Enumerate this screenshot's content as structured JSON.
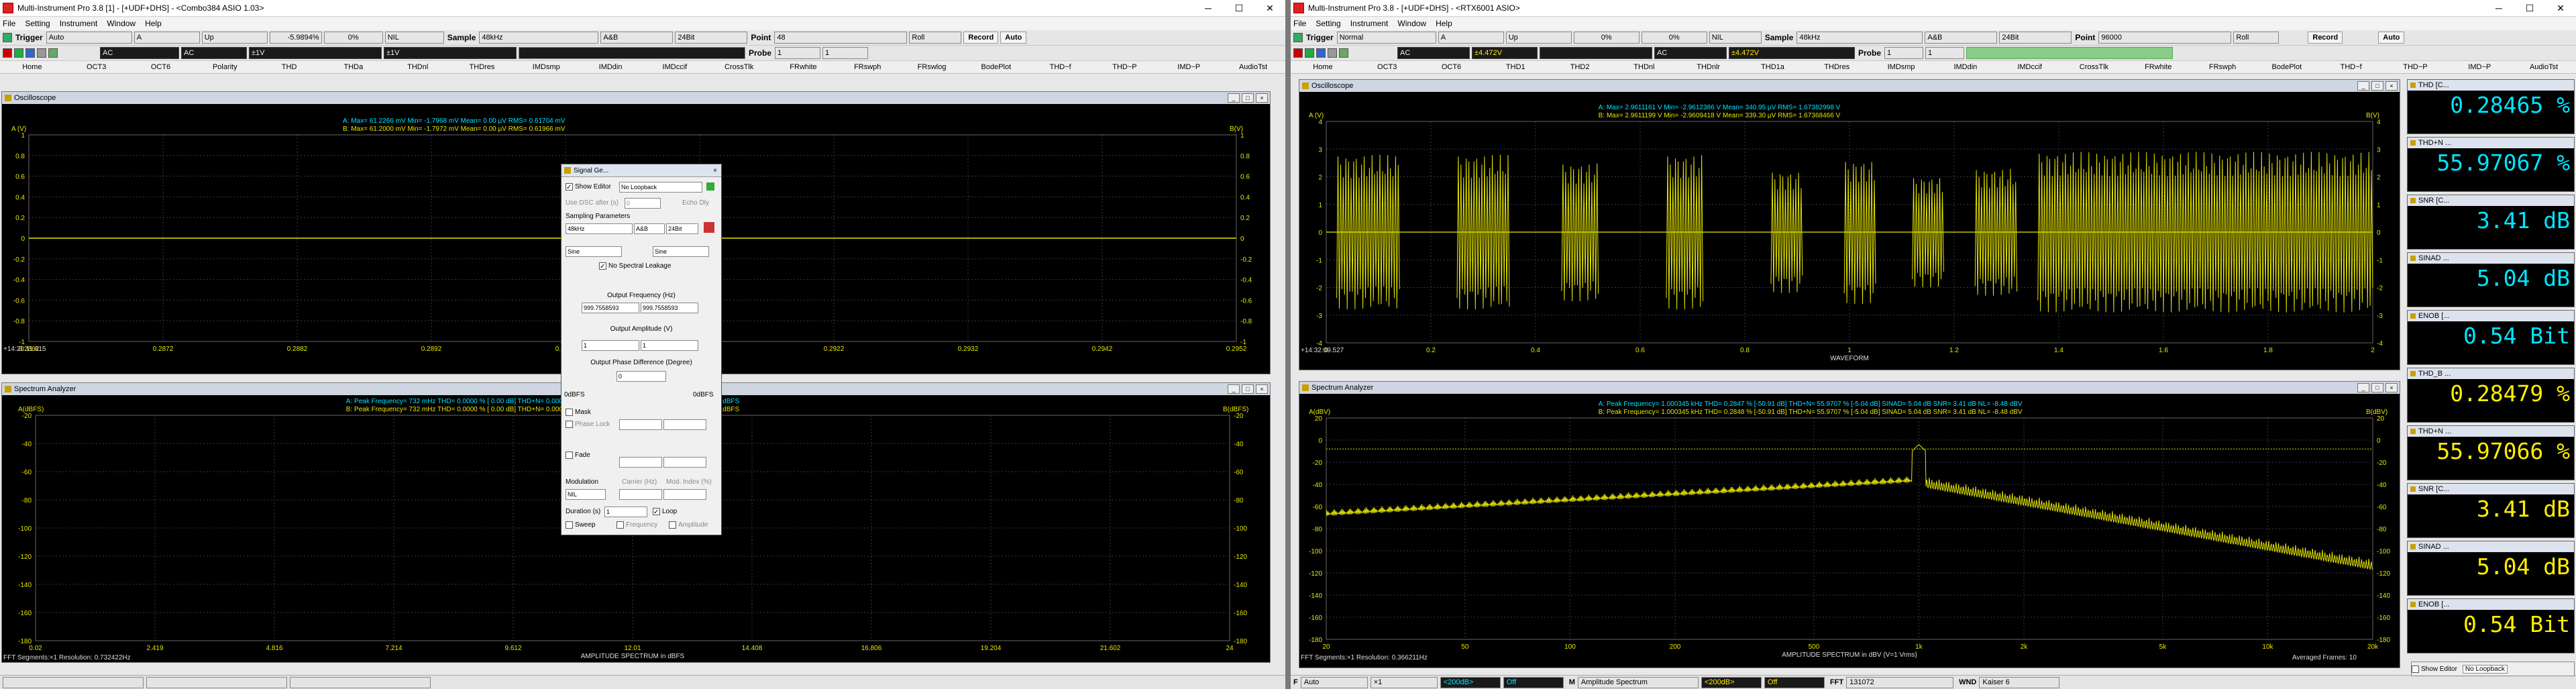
{
  "left": {
    "title": "Multi-Instrument Pro 3.8 [1] - [+UDF+DHS] - <Combo384 ASIO 1.03>",
    "menu": [
      "File",
      "Setting",
      "Instrument",
      "Window",
      "Help"
    ],
    "toolbar1": {
      "trigger": "Trigger",
      "trigger_mode": "Auto",
      "channel": "A",
      "edge": "Up",
      "level": "-5.9894%",
      "pct": "0%",
      "nil": "NIL",
      "sample_label": "Sample",
      "sample": "48kHz",
      "ab": "A&B",
      "bits": "24Bit",
      "point_label": "Point",
      "point": "48",
      "roll": "Roll",
      "record": "Record",
      "auto": "Auto"
    },
    "toolbar2": {
      "acA": "AC",
      "acB": "AC",
      "vA": "±1V",
      "vB": "±1V",
      "probe": "Probe",
      "probeA": "1",
      "probeB": "1"
    },
    "funcbar": [
      "Home",
      "OCT3",
      "OCT6",
      "Polarity",
      "THD",
      "THDa",
      "THDnl",
      "THDres",
      "IMDsmp",
      "IMDdin",
      "IMDccif",
      "CrossTlk",
      "FRwhite",
      "FRswph",
      "FRswlog",
      "BodePlot",
      "THD~f",
      "THD~P",
      "IMD~P",
      "AudioTst"
    ],
    "osc": {
      "title": "Oscilloscope",
      "axis_label": "A (V)",
      "axis_label_r": "B(V)",
      "yticks": [
        "1",
        "0.8",
        "0.6",
        "0.4",
        "0.2",
        "0",
        "-0.2",
        "-0.4",
        "-0.6",
        "-0.8",
        "-1"
      ],
      "xticks": [
        "0.2862",
        "0.2872",
        "0.2882",
        "0.2892",
        "0.2902",
        "0.2912",
        "0.2922",
        "0.2932",
        "0.2942",
        "0.2952"
      ],
      "time": "+14:20:11.615",
      "stats_a": "A: Max= 61.2266 mV Min= -1.7968 mV Mean= 0.00 µV RMS= 0.61704 mV",
      "stats_b": "B: Max= 61.2000 mV Min= -1.7972 mV Mean= 0.00 µV RMS= 0.61966 mV"
    },
    "spec": {
      "title": "Spectrum Analyzer",
      "axis_label": "A(dBFS)",
      "axis_label_r": "B(dBFS)",
      "yticks": [
        "-20",
        "-40",
        "-60",
        "-80",
        "-100",
        "-120",
        "-140",
        "-160",
        "-180"
      ],
      "xticks": [
        "0.02",
        "2.419",
        "4.816",
        "7.214",
        "9.612",
        "12.01",
        "14.408",
        "16.806",
        "19.204",
        "21.602",
        "24"
      ],
      "xlabel": "AMPLITUDE SPECTRUM in dBFS",
      "footer": "FFT Segments:×1     Resolution: 0.732422Hz",
      "stats_a": "A: Peak Frequency= 732 mHz THD= 0.0000 % [ 0.00 dB] THD+N= 0.0000 % SINAD= 0.00 dB SNR= 1000.00 dB NL= -193.05 dBFS",
      "stats_b": "B: Peak Frequency= 732 mHz THD= 0.0000 % [ 0.00 dB] THD+N= 0.0000 % SINAD= 0.00 dB SNR= 1000.00 dB NL= -192.21 dBFS"
    },
    "dialog": {
      "title": "Signal Ge...",
      "show_editor": "Show Editor",
      "loopback": "No Loopback",
      "use_dsc": "Use DSC after (s)",
      "dsc_val": "0",
      "echo": "Echo Dly",
      "sampling": "Sampling Parameters",
      "rate": "48kHz",
      "ch": "A&B",
      "bits": "24Bit",
      "waveA": "Sine",
      "waveB": "Sine",
      "no_leak": "No Spectral Leakage",
      "freq_lbl": "Output Frequency (Hz)",
      "freqA": "999.7558593",
      "freqB": "999.7558593",
      "amp_lbl": "Output Amplitude (V)",
      "ampA": "1",
      "ampB": "1",
      "phase_lbl": "Output Phase Difference (Degree)",
      "phase": "0",
      "db_l": "0dBFS",
      "db_r": "0dBFS",
      "mask": "Mask",
      "phase_lock": "Phase Lock",
      "fade": "Fade",
      "mod_lbl": "Modulation",
      "mod_val": "NIL",
      "carrier": "Carrier (Hz)",
      "mod_index": "Mod. Index (%)",
      "dur_lbl": "Duration (s)",
      "dur_val": "1",
      "loop": "Loop",
      "sweep": "Sweep",
      "frequency": "Frequency",
      "amplitude": "Amplitude"
    }
  },
  "right": {
    "title": "Multi-Instrument Pro 3.8 - [+UDF+DHS] - <RTX6001 ASIO>",
    "menu": [
      "File",
      "Setting",
      "Instrument",
      "Window",
      "Help"
    ],
    "toolbar1": {
      "trigger": "Trigger",
      "trigger_mode": "Normal",
      "channel": "A",
      "edge": "Up",
      "level": "0%",
      "pct": "0%",
      "nil": "NIL",
      "sample_label": "Sample",
      "sample": "48kHz",
      "ab": "A&B",
      "bits": "24Bit",
      "point_label": "Point",
      "point": "96000",
      "roll": "Roll",
      "record": "Record",
      "auto": "Auto"
    },
    "toolbar2": {
      "acA": "AC",
      "vA": "±4.472V",
      "acB": "AC",
      "vB": "±4.472V",
      "probe": "Probe",
      "probeA": "1",
      "probeB": "1"
    },
    "funcbar": [
      "Home",
      "OCT3",
      "OCT6",
      "THD1",
      "THD2",
      "THDnl",
      "THDnlr",
      "THD1a",
      "THDres",
      "IMDsmp",
      "IMDdin",
      "IMDccif",
      "CrossTlk",
      "FRwhite",
      "FRswph",
      "BodePlot",
      "THD~f",
      "THD~P",
      "IMD~P",
      "AudioTst"
    ],
    "osc": {
      "title": "Oscilloscope",
      "axis_label": "A (V)",
      "axis_label_r": "B(V)",
      "yticks": [
        "4",
        "3",
        "2",
        "1",
        "0",
        "-1",
        "-2",
        "-3",
        "-4"
      ],
      "xticks": [
        "0",
        "0.2",
        "0.4",
        "0.6",
        "0.8",
        "1",
        "1.2",
        "1.4",
        "1.6",
        "1.8",
        "2"
      ],
      "xlabel": "WAVEFORM",
      "time": "+14:32:09.527",
      "stats_a": "A: Max= 2.9611161 V Min= -2.9612386 V Mean= 340.95 µV RMS= 1.67382998 V",
      "stats_b": "B: Max= 2.9611199 V Min= -2.9609418 V Mean= 339.30 µV RMS= 1.67368466 V"
    },
    "spec": {
      "title": "Spectrum Analyzer",
      "axis_label": "A(dBV)",
      "axis_label_r": "B(dBV)",
      "yticks": [
        "20",
        "0",
        "-20",
        "-40",
        "-60",
        "-80",
        "-100",
        "-120",
        "-140",
        "-160",
        "-180"
      ],
      "xticks": [
        "20",
        "50",
        "100",
        "200",
        "500",
        "1k",
        "2k",
        "5k",
        "10k",
        "20k"
      ],
      "xlabel": "AMPLITUDE SPECTRUM in dBV (V=1 Vrms)",
      "footer": "FFT Segments:×1     Resolution: 0.366211Hz",
      "footer_r": "Averaged Frames: 10",
      "stats_a": "A: Peak Frequency= 1.000345 kHz THD= 0.2847 % [-50.91 dB] THD+N= 55.9707 % [-5.04 dB] SINAD= 5.04 dB SNR= 3.41 dB NL= -8.48 dBV",
      "stats_b": "B: Peak Frequency= 1.000345 kHz THD= 0.2848 % [-50.91 dB] THD+N= 55.9707 % [-5.04 dB] SINAD= 5.04 dB SNR= 3.41 dB NL= -8.48 dBV"
    },
    "status": {
      "f": "F",
      "f_val": "Auto",
      "mult": "×1",
      "db1": "<200dB>",
      "off1": "Off",
      "m": "M",
      "mode": "Amplitude Spectrum",
      "db2": "<200dB>",
      "off2": "Off",
      "fft": "FFT",
      "fft_val": "131072",
      "wnd": "WND",
      "wnd_val": "Kaiser 6",
      "show_editor": "Show Editor",
      "loopback": "No Loopback"
    },
    "readouts": [
      {
        "label": "THD [C...",
        "value": "0.28465 %",
        "color": "#00e5ff"
      },
      {
        "label": "THD+N ...",
        "value": "55.97067 %",
        "color": "#00e5ff"
      },
      {
        "label": "SNR [C...",
        "value": "3.41 dB",
        "color": "#00e5ff"
      },
      {
        "label": "SINAD ...",
        "value": "5.04 dB",
        "color": "#00e5ff"
      },
      {
        "label": "ENOB [...",
        "value": "0.54 Bit",
        "color": "#00e5ff"
      },
      {
        "label": "THD_B ...",
        "value": "0.28479 %",
        "color": "#ffee00"
      },
      {
        "label": "THD+N ...",
        "value": "55.97066 %",
        "color": "#ffee00"
      },
      {
        "label": "SNR [C...",
        "value": "3.41 dB",
        "color": "#ffee00"
      },
      {
        "label": "SINAD ...",
        "value": "5.04 dB",
        "color": "#ffee00"
      },
      {
        "label": "ENOB [...",
        "value": "0.54 Bit",
        "color": "#ffee00"
      }
    ]
  },
  "colors": {
    "trace": "#e6e600",
    "grid": "#3a3a3a",
    "cyan": "#00e5ff",
    "tick": "#e6e600"
  }
}
